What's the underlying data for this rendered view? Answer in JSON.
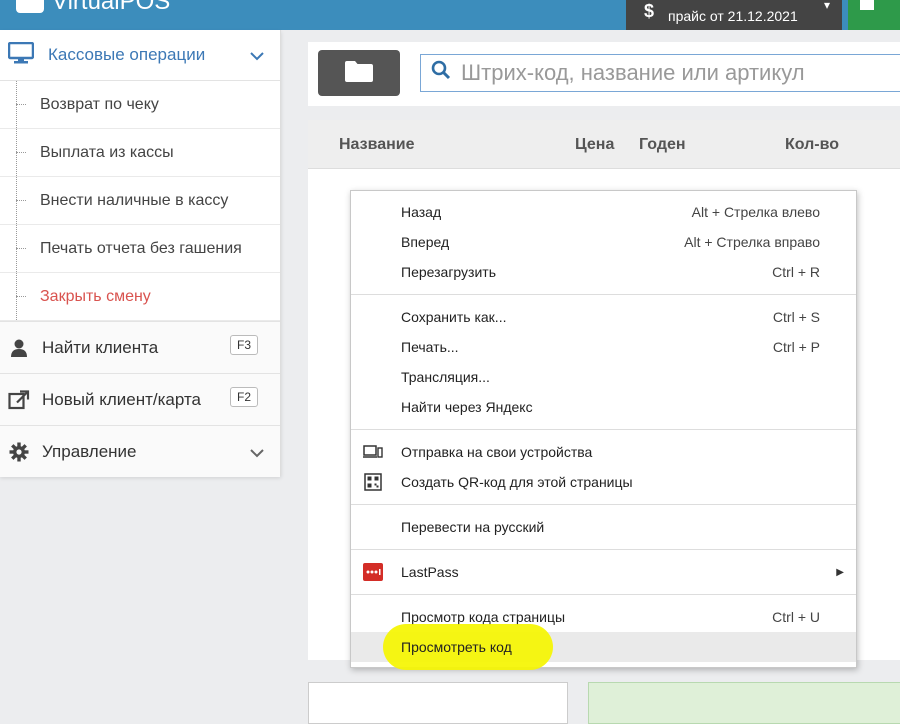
{
  "app": {
    "title": "VirtualPOS"
  },
  "topbar": {
    "price_label": "прайс от 21.12.2021",
    "currency_symbol": "$",
    "caret": "▾"
  },
  "sidebar": {
    "section": {
      "label": "Кассовые операции"
    },
    "sub_items": [
      {
        "label": "Возврат по чеку"
      },
      {
        "label": "Выплата из кассы"
      },
      {
        "label": "Внести наличные в кассу"
      },
      {
        "label": "Печать отчета без гашения"
      },
      {
        "label": "Закрыть смену"
      }
    ],
    "find_client": {
      "label": "Найти клиента",
      "key": "F3"
    },
    "new_client": {
      "label": "Новый клиент/карта",
      "key": "F2"
    },
    "management": {
      "label": "Управление"
    }
  },
  "search": {
    "placeholder": "Штрих-код, название или артикул"
  },
  "table": {
    "columns": [
      "Название",
      "Цена",
      "Годен",
      "Кол-во"
    ]
  },
  "context_menu": {
    "group1": [
      {
        "label": "Назад",
        "shortcut": "Alt + Стрелка влево"
      },
      {
        "label": "Вперед",
        "shortcut": "Alt + Стрелка вправо"
      },
      {
        "label": "Перезагрузить",
        "shortcut": "Ctrl + R"
      }
    ],
    "group2": [
      {
        "label": "Сохранить как...",
        "shortcut": "Ctrl + S"
      },
      {
        "label": "Печать...",
        "shortcut": "Ctrl + P"
      },
      {
        "label": "Трансляция..."
      },
      {
        "label": "Найти через Яндекс"
      }
    ],
    "group3": [
      {
        "label": "Отправка на свои устройства"
      },
      {
        "label": "Создать QR-код для этой страницы"
      }
    ],
    "translate": {
      "label": "Перевести на русский"
    },
    "lastpass": {
      "label": "LastPass"
    },
    "view_source": {
      "label": "Просмотр кода страницы",
      "shortcut": "Ctrl + U"
    },
    "inspect": {
      "label": "Просмотреть код"
    }
  },
  "colors": {
    "accent": "#3c8dbc",
    "danger": "#d9534f",
    "highlight": "#f5f500",
    "lastpass": "#d32d27"
  }
}
